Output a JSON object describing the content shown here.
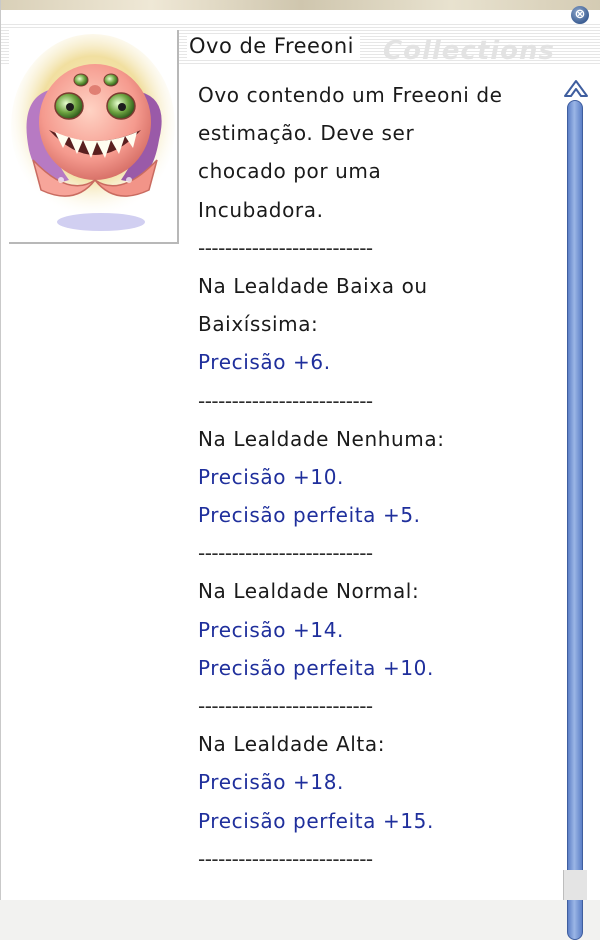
{
  "window": {
    "title": "Ovo de Freeoni",
    "watermark": "Collections",
    "close_symbol": "⊗"
  },
  "description": {
    "lines": [
      {
        "text": "Ovo contendo um Freeoni de",
        "kind": "normal"
      },
      {
        "text": "estimação. Deve ser",
        "kind": "normal"
      },
      {
        "text": "chocado por uma",
        "kind": "normal"
      },
      {
        "text": "Incubadora.",
        "kind": "normal"
      },
      {
        "text": "--------------------------",
        "kind": "sep"
      },
      {
        "text": "Na Lealdade Baixa ou",
        "kind": "normal"
      },
      {
        "text": "Baixíssima:",
        "kind": "normal"
      },
      {
        "text": "Precisão +6.",
        "kind": "blue"
      },
      {
        "text": "--------------------------",
        "kind": "sep"
      },
      {
        "text": "Na Lealdade Nenhuma:",
        "kind": "normal"
      },
      {
        "text": "Precisão +10.",
        "kind": "blue"
      },
      {
        "text": "Precisão perfeita +5.",
        "kind": "blue"
      },
      {
        "text": "--------------------------",
        "kind": "sep"
      },
      {
        "text": "Na Lealdade Normal:",
        "kind": "normal"
      },
      {
        "text": "Precisão +14.",
        "kind": "blue"
      },
      {
        "text": "Precisão perfeita +10.",
        "kind": "blue"
      },
      {
        "text": "--------------------------",
        "kind": "sep"
      },
      {
        "text": "Na Lealdade Alta:",
        "kind": "normal"
      },
      {
        "text": "Precisão +18.",
        "kind": "blue"
      },
      {
        "text": "Precisão perfeita +15.",
        "kind": "blue"
      },
      {
        "text": "--------------------------",
        "kind": "sep"
      }
    ]
  },
  "colors": {
    "bonus_text": "#1f2f9c",
    "body_text": "#1a1a1a",
    "scrollbar": "#5d80c7"
  },
  "icons": {
    "close": "close-icon",
    "scroll_up": "chevron-up-icon",
    "portrait": "freeoni-egg-illustration"
  }
}
